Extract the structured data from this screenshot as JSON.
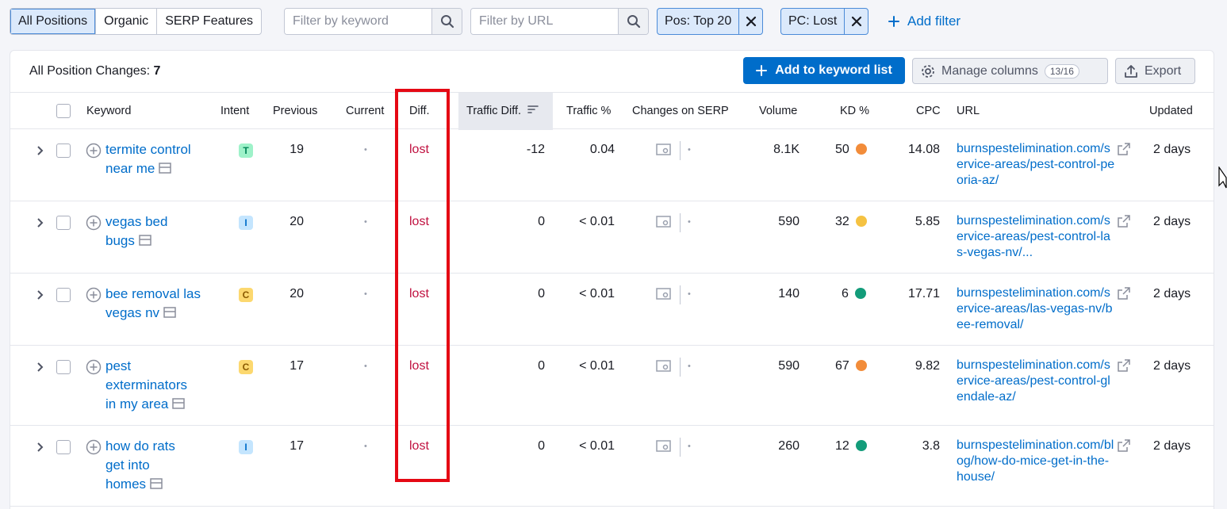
{
  "filters": {
    "segments": [
      "All Positions",
      "Organic",
      "SERP Features"
    ],
    "keyword_placeholder": "Filter by keyword",
    "url_placeholder": "Filter by URL",
    "chips": [
      "Pos: Top 20",
      "PC: Lost"
    ],
    "add_filter": "Add filter"
  },
  "card": {
    "title_label": "All Position Changes: ",
    "title_count": "7",
    "add_to_list": "Add to keyword list",
    "manage_columns": "Manage columns",
    "columns_badge": "13/16",
    "export": "Export"
  },
  "columns": {
    "keyword": "Keyword",
    "intent": "Intent",
    "previous": "Previous",
    "current": "Current",
    "diff": "Diff.",
    "traffic_diff": "Traffic Diff.",
    "traffic_pct": "Traffic %",
    "changes_serp": "Changes on SERP",
    "volume": "Volume",
    "kd": "KD %",
    "cpc": "CPC",
    "url": "URL",
    "updated": "Updated"
  },
  "rows": [
    {
      "keyword": "termite control near me",
      "intent": "T",
      "previous": "19",
      "current": "•",
      "diff": "lost",
      "traffic_diff": "-12",
      "traffic_pct": "0.04",
      "volume": "8.1K",
      "kd": "50",
      "kd_color": "#f28c3a",
      "cpc": "14.08",
      "url": "burnspestelimination.com/service-areas/pest-control-peoria-az/",
      "updated": "2 days"
    },
    {
      "keyword": "vegas bed bugs",
      "intent": "I",
      "previous": "20",
      "current": "•",
      "diff": "lost",
      "traffic_diff": "0",
      "traffic_pct": "< 0.01",
      "volume": "590",
      "kd": "32",
      "kd_color": "#f5c242",
      "cpc": "5.85",
      "url": "burnspestelimination.com/service-areas/pest-control-las-vegas-nv/...",
      "updated": "2 days"
    },
    {
      "keyword": "bee removal las vegas nv",
      "intent": "C",
      "previous": "20",
      "current": "•",
      "diff": "lost",
      "traffic_diff": "0",
      "traffic_pct": "< 0.01",
      "volume": "140",
      "kd": "6",
      "kd_color": "#139c7a",
      "cpc": "17.71",
      "url": "burnspestelimination.com/service-areas/las-vegas-nv/bee-removal/",
      "updated": "2 days"
    },
    {
      "keyword": "pest exterminators in my area",
      "intent": "C",
      "previous": "17",
      "current": "•",
      "diff": "lost",
      "traffic_diff": "0",
      "traffic_pct": "< 0.01",
      "volume": "590",
      "kd": "67",
      "kd_color": "#f28c3a",
      "cpc": "9.82",
      "url": "burnspestelimination.com/service-areas/pest-control-glendale-az/",
      "updated": "2 days"
    },
    {
      "keyword": "how do rats get into homes",
      "intent": "I",
      "previous": "17",
      "current": "•",
      "diff": "lost",
      "traffic_diff": "0",
      "traffic_pct": "< 0.01",
      "volume": "260",
      "kd": "12",
      "kd_color": "#139c7a",
      "cpc": "3.8",
      "url": "burnspestelimination.com/blog/how-do-mice-get-in-the-house/",
      "updated": "2 days"
    }
  ],
  "colors": {
    "accent": "#006dca",
    "lost": "#c0103f",
    "highlight_box": "#e50914"
  }
}
